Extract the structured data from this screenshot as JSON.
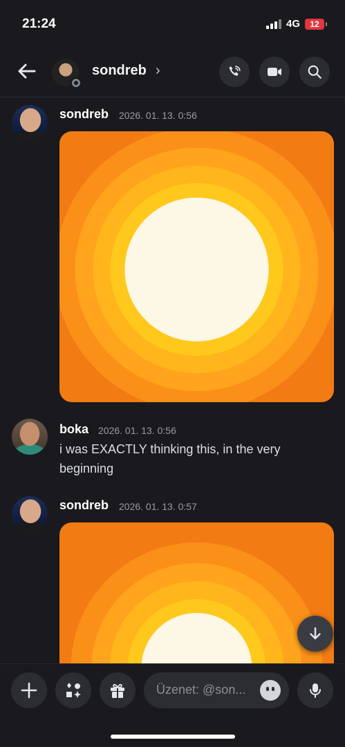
{
  "status_bar": {
    "time": "21:24",
    "network": "4G",
    "battery": "12"
  },
  "header": {
    "username": "sondreb",
    "chevron": "›"
  },
  "messages": [
    {
      "author": "sondreb",
      "timestamp": "2026. 01. 13. 0:56",
      "attachment": "image"
    },
    {
      "author": "boka",
      "timestamp": "2026. 01. 13. 0:56",
      "text": "i was EXACTLY thinking this, in the very beginning"
    },
    {
      "author": "sondreb",
      "timestamp": "2026. 01. 13. 0:57",
      "attachment": "image"
    }
  ],
  "composer": {
    "placeholder": "Üzenet: @son..."
  },
  "icons": [
    "back-arrow-icon",
    "phone-icon",
    "video-camera-icon",
    "search-icon",
    "scroll-down-arrow-icon",
    "plus-icon",
    "apps-icon",
    "gift-icon",
    "emoji-icon",
    "microphone-icon"
  ],
  "colors": {
    "background": "#1a1a1e",
    "button": "#2b2d31",
    "battery": "#e0383e",
    "sun_center": "#fdf7e6",
    "sun_outer": "#f27b14"
  }
}
